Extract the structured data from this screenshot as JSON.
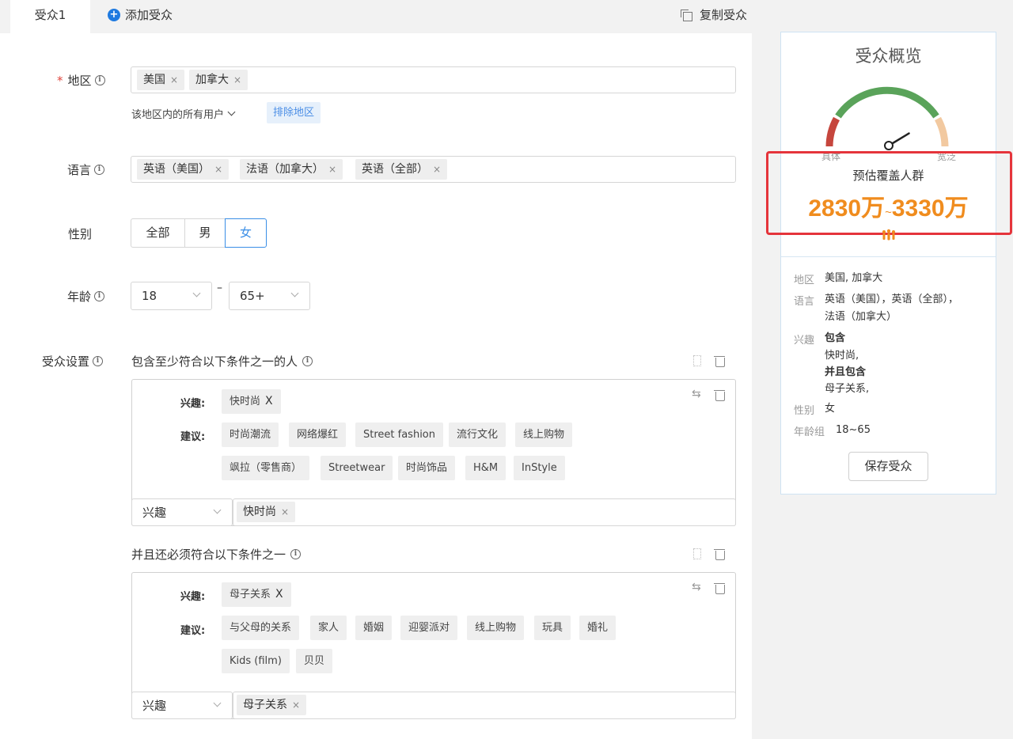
{
  "tabs": {
    "active": "受众1",
    "add": "添加受众",
    "copy": "复制受众"
  },
  "region": {
    "label": "地区",
    "chips": [
      "美国",
      "加拿大"
    ],
    "scope": "该地区内的所有用户",
    "exclude": "排除地区"
  },
  "language": {
    "label": "语言",
    "chips": [
      "英语（美国）",
      "法语（加拿大）",
      "英语（全部）"
    ]
  },
  "gender": {
    "label": "性别",
    "options": [
      "全部",
      "男",
      "女"
    ],
    "selected": "女"
  },
  "age": {
    "label": "年龄",
    "min": "18",
    "dash": "–",
    "max": "65+"
  },
  "audience": {
    "label": "受众设置",
    "group1": {
      "title": "包含至少符合以下条件之一的人",
      "interest_label": "兴趣:",
      "suggest_label": "建议:",
      "selected": "快时尚",
      "selected_x": "X",
      "suggestions_row1": [
        "时尚潮流",
        "网络爆红",
        "Street fashion",
        "流行文化",
        "线上购物"
      ],
      "suggestions_row2": [
        "飒拉（零售商）",
        "Streetwear",
        "时尚饰品",
        "H&M",
        "InStyle"
      ],
      "type": "兴趣",
      "input_chip": "快时尚"
    },
    "group2": {
      "title": "并且还必须符合以下条件之一",
      "interest_label": "兴趣:",
      "suggest_label": "建议:",
      "selected": "母子关系",
      "selected_x": "X",
      "suggestions_row1": [
        "与父母的关系",
        "家人",
        "婚姻",
        "迎婴派对",
        "线上购物",
        "玩具",
        "婚礼"
      ],
      "suggestions_row2": [
        "Kids (film)",
        "贝贝"
      ],
      "type": "兴趣",
      "input_chip": "母子关系"
    }
  },
  "summary": {
    "title": "受众概览",
    "gauge": {
      "left_label": "具体",
      "right_label": "宽泛",
      "needle_level": 0.72
    },
    "estimate_label": "预估覆盖人群",
    "estimate_low": "2830万",
    "estimate_tilde": "~",
    "estimate_high": "3330万",
    "region_key": "地区",
    "region_val": "美国, 加拿大",
    "language_key": "语言",
    "language_val_1": "英语（美国），英语（全部），",
    "language_val_2": "法语（加拿大）",
    "interest_key": "兴趣",
    "interest_include": "包含",
    "interest_1": "快时尚,",
    "interest_and": "并且包含",
    "interest_2": "母子关系,",
    "gender_key": "性别",
    "gender_val": "女",
    "age_key": "年龄组",
    "age_val": "18~65",
    "save": "保存受众"
  },
  "colors": {
    "accent": "#3a8ee6",
    "estimate": "#f08c1e",
    "highlight": "#e5343b",
    "gauge_green": "#5aa35a",
    "gauge_red": "#c6463d",
    "gauge_peach": "#f2c9a0"
  }
}
